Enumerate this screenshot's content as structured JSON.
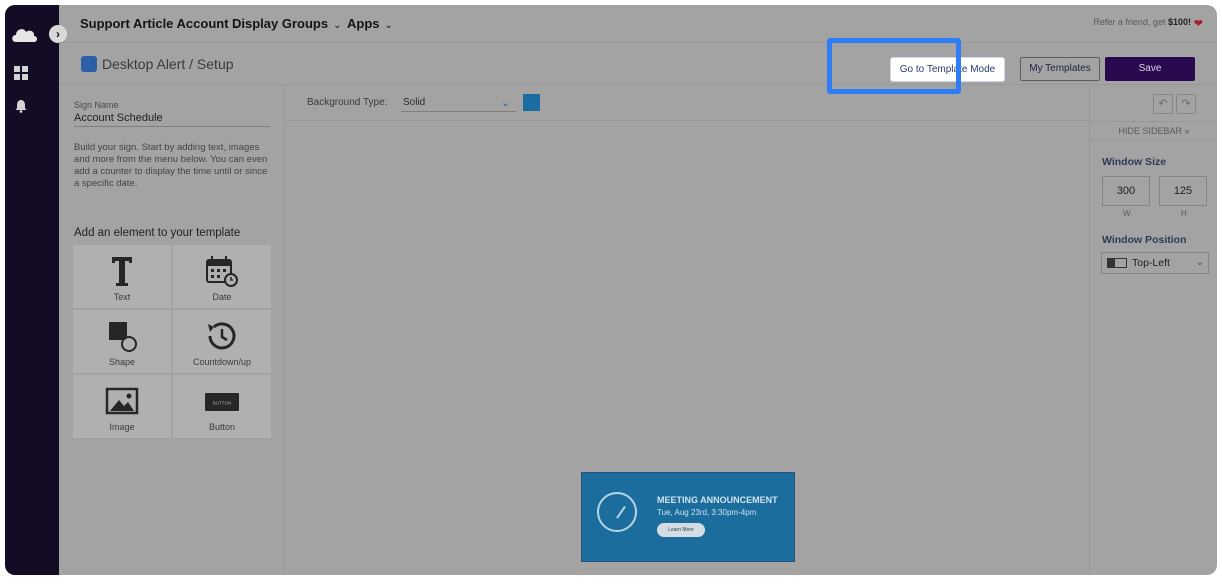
{
  "topbar": {
    "menus": [
      {
        "label": "Support Article Account"
      },
      {
        "label": "Display Groups"
      },
      {
        "label": "Apps"
      }
    ],
    "refer_text": "Refer a friend, get",
    "refer_amount": "$100!"
  },
  "subbar": {
    "breadcrumb": "Desktop Alert / Setup",
    "template_mode_label": "Go to Template Mode",
    "my_templates_label": "My Templates",
    "save_label": "Save"
  },
  "left_panel": {
    "sign_name_label": "Sign Name",
    "sign_name_value": "Account Schedule",
    "instructions": "Build your sign. Start by adding text, images and more from the menu below. You can even add a counter to display the time until or since a specific date.",
    "add_title": "Add an element to your template",
    "elements": [
      {
        "label": "Text",
        "icon": "text-icon"
      },
      {
        "label": "Date",
        "icon": "calendar-icon"
      },
      {
        "label": "Shape",
        "icon": "shape-icon"
      },
      {
        "label": "Countdown/up",
        "icon": "countdown-icon"
      },
      {
        "label": "Image",
        "icon": "image-icon"
      },
      {
        "label": "Button",
        "icon": "button-icon",
        "icon_text": "BUTTON"
      }
    ]
  },
  "background": {
    "label": "Background Type:",
    "value": "Solid",
    "color": "#1b6da1"
  },
  "preview": {
    "title": "MEETING ANNOUNCEMENT",
    "date": "Tue, Aug 23rd, 3:30pm-4pm",
    "button_label": "Learn More"
  },
  "right_panel": {
    "hide_sidebar": "HIDE SIDEBAR »",
    "window_size_title": "Window Size",
    "width": "300",
    "height": "125",
    "w_label": "W",
    "h_label": "H",
    "window_position_title": "Window Position",
    "position_value": "Top-Left"
  },
  "colors": {
    "nav_bg": "#130c24",
    "save_bg": "#2a0a4e",
    "highlight": "#2e7cf6",
    "preview_bg": "#1b6d9e"
  }
}
